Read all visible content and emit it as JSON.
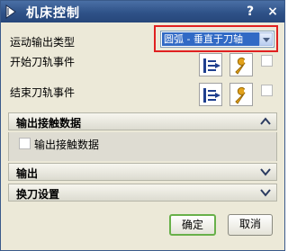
{
  "window": {
    "title": "机床控制",
    "help_glyph": "?",
    "close_glyph": "×"
  },
  "motion_output": {
    "label": "运动输出类型",
    "selected": "圆弧 - 垂直于刀轴"
  },
  "start_event": {
    "label": "开始刀轨事件"
  },
  "end_event": {
    "label": "结束刀轨事件"
  },
  "sections": {
    "contact_data": {
      "title": "输出接触数据",
      "expanded": true,
      "checkbox_label": "输出接触数据",
      "checked": false
    },
    "output": {
      "title": "输出",
      "expanded": false
    },
    "tool_change": {
      "title": "换刀设置",
      "expanded": false
    }
  },
  "buttons": {
    "ok": "确定",
    "cancel": "取消"
  },
  "colors": {
    "titlebar": "#2f5288",
    "selection": "#316ac5",
    "highlight_frame": "#e02020",
    "ok_border": "#68b04a"
  }
}
